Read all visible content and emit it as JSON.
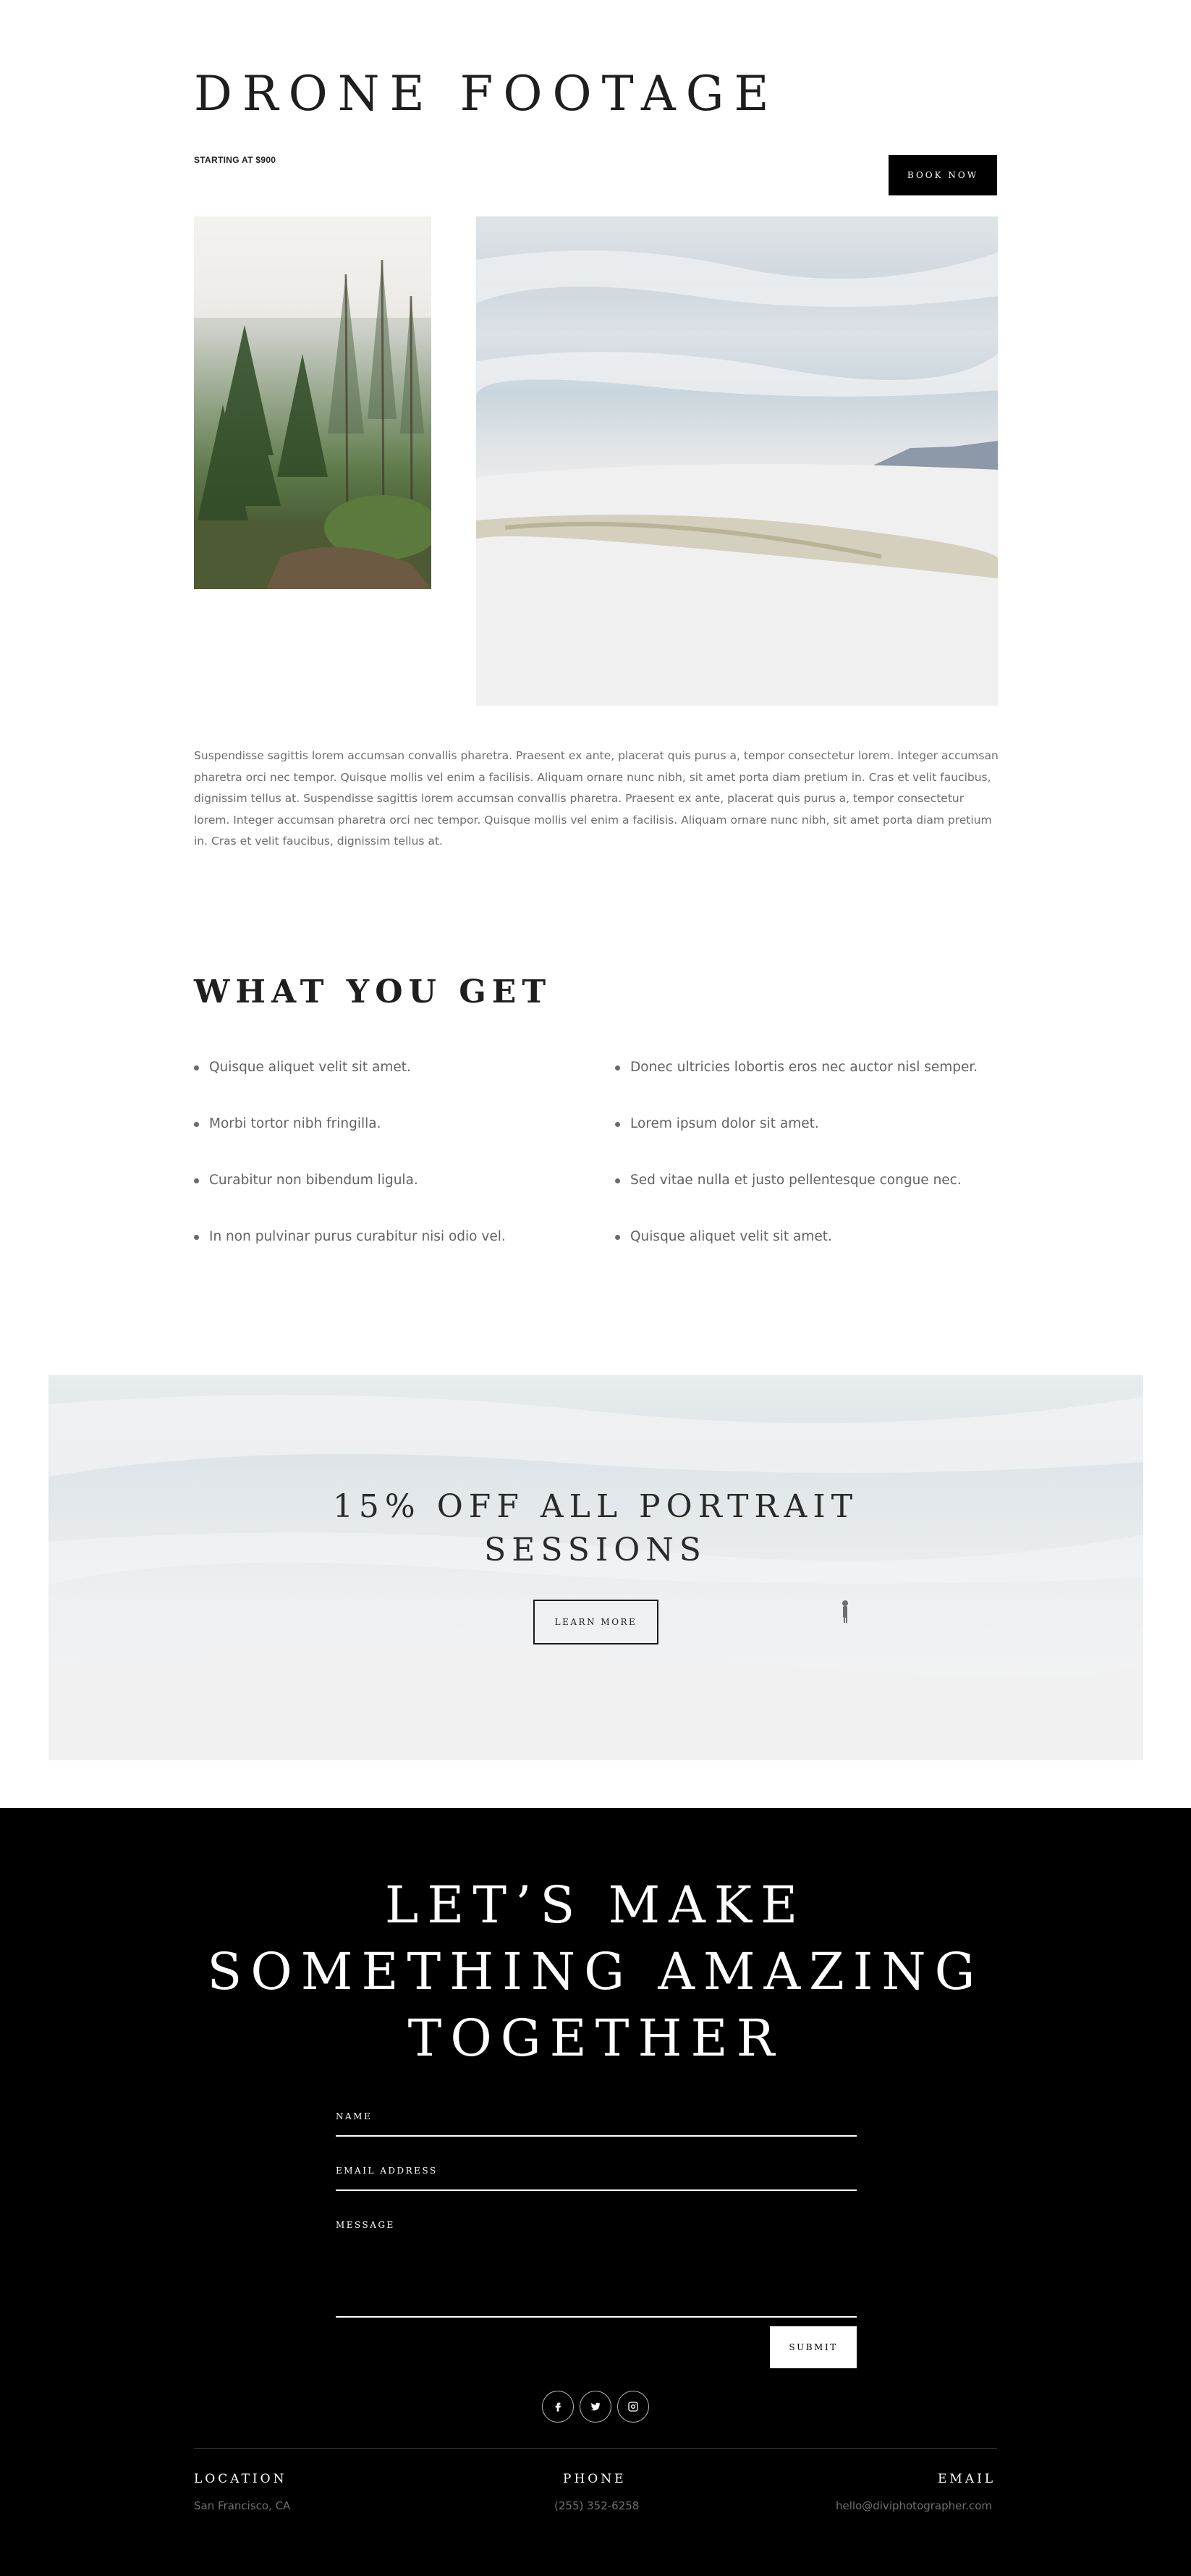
{
  "header": {
    "title": "DRONE FOOTAGE",
    "price": "STARTING AT $900",
    "book_label": "BOOK NOW"
  },
  "intro": {
    "text": "Suspendisse sagittis lorem accumsan convallis pharetra. Praesent ex ante, placerat quis purus a, tempor consectetur lorem. Integer accumsan pharetra orci nec tempor. Quisque mollis vel enim a facilisis. Aliquam ornare nunc nibh, sit amet porta diam pretium in. Cras et velit faucibus, dignissim tellus at. Suspendisse sagittis lorem accumsan convallis pharetra. Praesent ex ante, placerat quis purus a, tempor consectetur lorem. Integer accumsan pharetra orci nec tempor. Quisque mollis vel enim a facilisis. Aliquam ornare nunc nibh, sit amet porta diam pretium in. Cras et velit faucibus, dignissim tellus at."
  },
  "features": {
    "title": "WHAT YOU GET",
    "left": [
      "Quisque aliquet velit sit amet.",
      "Morbi tortor nibh fringilla.",
      "Curabitur non bibendum ligula.",
      "In non pulvinar purus curabitur nisi odio vel."
    ],
    "right": [
      "Donec ultricies lobortis eros nec auctor nisl semper.",
      "Lorem ipsum dolor sit amet.",
      "Sed vitae nulla et justo pellentesque congue nec.",
      "Quisque aliquet velit sit amet."
    ]
  },
  "promo": {
    "title_line1": "15% OFF ALL PORTRAIT",
    "title_line2": "SESSIONS",
    "button_label": "LEARN MORE"
  },
  "contact": {
    "cta_line1": "LET’S MAKE",
    "cta_line2": "SOMETHING AMAZING",
    "cta_line3": "TOGETHER",
    "name_label": "NAME",
    "email_label": "EMAIL ADDRESS",
    "message_label": "MESSAGE",
    "submit_label": "SUBMIT"
  },
  "social": [
    "facebook-icon",
    "twitter-icon",
    "instagram-icon"
  ],
  "footer": {
    "location_label": "LOCATION",
    "location_value": "San Francisco, CA",
    "phone_label": "PHONE",
    "phone_value": "(255) 352-6258",
    "email_label": "EMAIL",
    "email_value": "hello@diviphotographer.com"
  },
  "colors": {
    "background": "#ffffff",
    "dark_section": "#000000",
    "heading": "#1e1e1e",
    "body_text": "#6d6d6d",
    "footer_value": "#6e6e6e"
  }
}
